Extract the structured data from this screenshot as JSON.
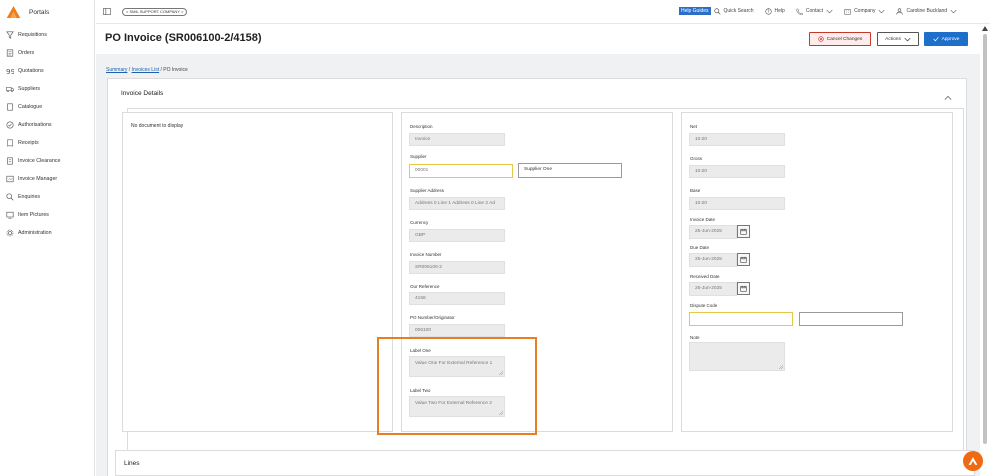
{
  "app": {
    "brand": "Portals",
    "company_pill": "< SMIL SUPPORT COMPANY >"
  },
  "sidebar": {
    "items": [
      {
        "label": "Requisitions",
        "icon": "requisitions-icon"
      },
      {
        "label": "Orders",
        "icon": "orders-icon"
      },
      {
        "label": "Quotations",
        "icon": "quotations-icon"
      },
      {
        "label": "Suppliers",
        "icon": "suppliers-icon"
      },
      {
        "label": "Catalogue",
        "icon": "catalogue-icon"
      },
      {
        "label": "Authorisations",
        "icon": "authorisations-icon"
      },
      {
        "label": "Receipts",
        "icon": "receipts-icon"
      },
      {
        "label": "Invoice Clearance",
        "icon": "invoice-clearance-icon"
      },
      {
        "label": "Invoice Manager",
        "icon": "invoice-manager-icon"
      },
      {
        "label": "Enquiries",
        "icon": "enquiries-icon"
      },
      {
        "label": "Item Pictures",
        "icon": "item-pictures-icon"
      },
      {
        "label": "Administration",
        "icon": "administration-icon"
      }
    ]
  },
  "topbar": {
    "help_guides": "Help Guides",
    "quick_search": "Quick Search",
    "help": "Help",
    "contact": "Contact",
    "company": "Company",
    "user": "Caroline Buckland"
  },
  "header": {
    "title": "PO Invoice (SR006100-2/4158)",
    "cancel_changes": "Cancel Changes",
    "actions": "Actions",
    "approve": "Approve"
  },
  "breadcrumb": {
    "summary": "Summary",
    "invoices_list": "Invoices List",
    "current": "PO Invoice"
  },
  "invoice": {
    "section_title": "Invoice Details",
    "no_document": "No document to display",
    "description_label": "Description",
    "description_value": "Invoice",
    "supplier_label": "Supplier",
    "supplier_code": "00001",
    "supplier_name": "Supplier One",
    "supplier_address_label": "Supplier Address",
    "supplier_address_value": "Address 0 Line 1 Address 0 Line 2 Ad",
    "currency_label": "Currency",
    "currency_value": "GBP",
    "invoice_number_label": "Invoice Number",
    "invoice_number_value": "SR006100-2",
    "our_reference_label": "Our Reference",
    "our_reference_value": "4158",
    "po_number_label": "PO Number/Originator",
    "po_number_value": "006100",
    "label_one": "Label One",
    "label_one_value": "Value One For External Reference 1",
    "label_two": "Label Two",
    "label_two_value": "Value Two For External Reference 2",
    "net_label": "Net",
    "net_value": "10.00",
    "gross_label": "Gross",
    "gross_value": "10.00",
    "base_label": "Base",
    "base_value": "10.00",
    "invoice_date_label": "Invoice Date",
    "invoice_date_value": "25-Jun-2025",
    "due_date_label": "Due Date",
    "due_date_value": "25-Jun-2025",
    "received_date_label": "Received Date",
    "received_date_value": "25-Jun-2025",
    "dispute_code_label": "Dispute Code",
    "dispute_code_value": "",
    "dispute_code_desc": "",
    "note_label": "Note",
    "note_value": ""
  },
  "lines": {
    "title": "Lines"
  },
  "colors": {
    "accent": "#1e6fc9",
    "brand": "#f06a14",
    "highlight": "#e67e22",
    "danger": "#c0392b"
  }
}
